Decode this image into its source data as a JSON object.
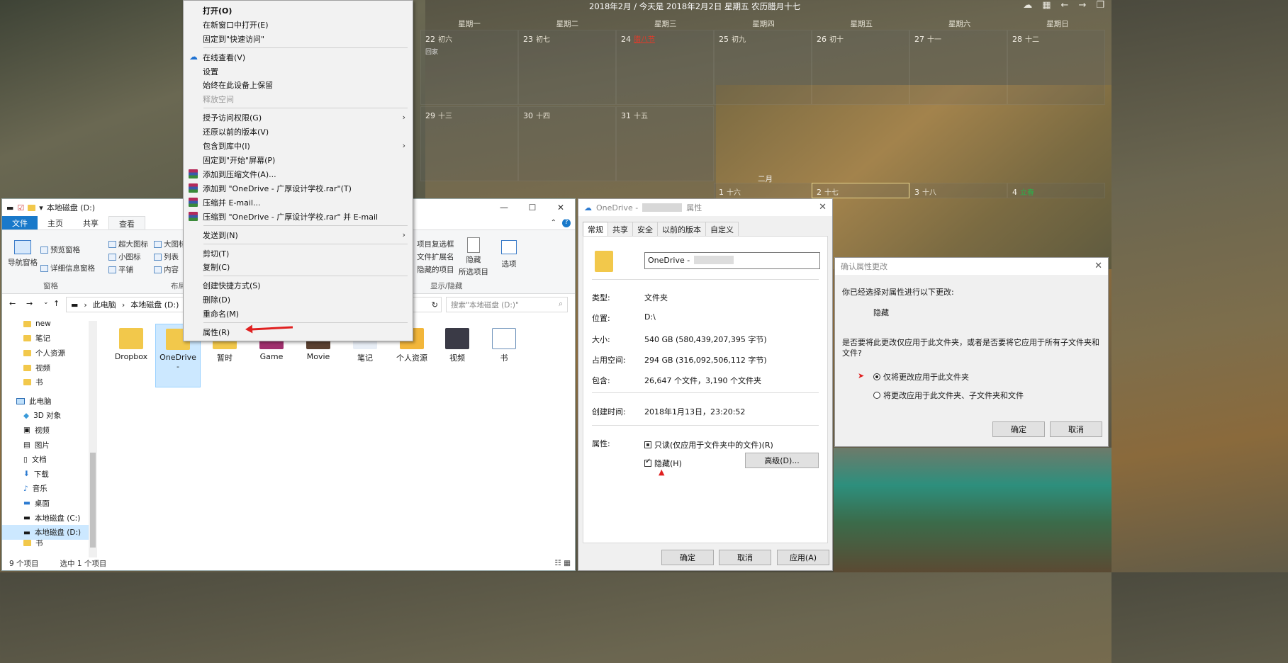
{
  "calendar": {
    "title": "2018年2月 / 今天是 2018年2月2日 星期五 农历腊月十七",
    "weekdays": [
      "星期一",
      "星期二",
      "星期三",
      "星期四",
      "星期五",
      "星期六",
      "星期日"
    ],
    "row1": [
      {
        "day": "22",
        "lunar": "初六",
        "note": "回家"
      },
      {
        "day": "23",
        "lunar": "初七"
      },
      {
        "day": "24",
        "lunar": "腊八节"
      },
      {
        "day": "25",
        "lunar": "初九"
      },
      {
        "day": "26",
        "lunar": "初十"
      },
      {
        "day": "27",
        "lunar": "十一"
      },
      {
        "day": "28",
        "lunar": "十二"
      }
    ],
    "row2": [
      {
        "day": "29",
        "lunar": "十三"
      },
      {
        "day": "30",
        "lunar": "十四"
      },
      {
        "day": "31",
        "lunar": "十五"
      }
    ],
    "feb_label": "二月",
    "row3": [
      {
        "day": "1",
        "lunar": "十六"
      },
      {
        "day": "2",
        "lunar": "十七"
      },
      {
        "day": "3",
        "lunar": "十八"
      },
      {
        "day": "4",
        "lunar": "立春"
      }
    ],
    "icons": [
      "cloud-icon",
      "calendar-icon",
      "back-arrow-icon",
      "forward-arrow-icon",
      "window-icon"
    ]
  },
  "explorer": {
    "title": "本地磁盘 (D:)",
    "tabs": {
      "file": "文件",
      "home": "主页",
      "share": "共享",
      "view": "查看"
    },
    "ribbon": {
      "nav_pane": "导航窗格",
      "preview_pane": "预览窗格",
      "details_pane": "详细信息窗格",
      "panes_group": "窗格",
      "xl_icons": "超大图标",
      "large_icons": "大图标",
      "small_icons": "小图标",
      "list": "列表",
      "tiles": "平铺",
      "content": "内容",
      "layout_group": "布局",
      "item_checkboxes": "项目复选框",
      "file_ext": "文件扩展名",
      "hidden_items": "隐藏的项目",
      "hide_selected": "隐藏",
      "selected_items": "所选项目",
      "options": "选项",
      "show_hide_group": "显示/隐藏"
    },
    "address": {
      "pc": "此电脑",
      "drive": "本地磁盘 (D:)"
    },
    "search_placeholder": "搜索\"本地磁盘 (D:)\"",
    "nav": {
      "folders": [
        "new",
        "笔记",
        "个人资源",
        "视频",
        "书"
      ],
      "this_pc": "此电脑",
      "pc_items": [
        "3D 对象",
        "视频",
        "图片",
        "文档",
        "下载",
        "音乐",
        "桌面",
        "本地磁盘 (C:)",
        "本地磁盘 (D:)"
      ],
      "partial": "书"
    },
    "files": [
      "Dropbox",
      "OneDrive",
      "暂时",
      "Game",
      "Movie",
      "笔记",
      "个人资源",
      "视频",
      "书"
    ],
    "onedrive_sub": "-",
    "status": {
      "count": "9 个项目",
      "selected": "选中 1 个项目"
    }
  },
  "context_menu": {
    "open": "打开(O)",
    "open_new": "在新窗口中打开(E)",
    "pin_quick": "固定到\"快速访问\"",
    "view_online": "在线查看(V)",
    "settings": "设置",
    "keep_device": "始终在此设备上保留",
    "free_space": "释放空间",
    "grant_access": "授予访问权限(G)",
    "restore": "还原以前的版本(V)",
    "include_lib": "包含到库中(I)",
    "pin_start": "固定到\"开始\"屏幕(P)",
    "add_archive": "添加到压缩文件(A)...",
    "add_rar": "添加到 \"OneDrive - 广厚设计学校.rar\"(T)",
    "compress_email": "压缩并 E-mail...",
    "compress_rar_email": "压缩到 \"OneDrive - 广厚设计学校.rar\" 并 E-mail",
    "send_to": "发送到(N)",
    "cut": "剪切(T)",
    "copy": "复制(C)",
    "shortcut": "创建快捷方式(S)",
    "delete": "删除(D)",
    "rename": "重命名(M)",
    "properties": "属性(R)"
  },
  "properties": {
    "title_prefix": "OneDrive -",
    "title_suffix": "属性",
    "tabs": [
      "常规",
      "共享",
      "安全",
      "以前的版本",
      "自定义"
    ],
    "name_value": "OneDrive -",
    "rows": [
      {
        "label": "类型:",
        "value": "文件夹"
      },
      {
        "label": "位置:",
        "value": "D:\\"
      },
      {
        "label": "大小:",
        "value": "540 GB (580,439,207,395 字节)"
      },
      {
        "label": "占用空间:",
        "value": "294 GB (316,092,506,112 字节)"
      },
      {
        "label": "包含:",
        "value": "26,647 个文件，3,190 个文件夹"
      }
    ],
    "created_label": "创建时间:",
    "created_value": "2018年1月13日，23:20:52",
    "attr_label": "属性:",
    "readonly": "只读(仅应用于文件夹中的文件)(R)",
    "hidden": "隐藏(H)",
    "advanced": "高级(D)...",
    "ok": "确定",
    "cancel": "取消",
    "apply": "应用(A)"
  },
  "confirm": {
    "title": "确认属性更改",
    "line1": "你已经选择对属性进行以下更改:",
    "change": "隐藏",
    "question": "是否要将此更改仅应用于此文件夹，或者是否要将它应用于所有子文件夹和文件?",
    "opt1": "仅将更改应用于此文件夹",
    "opt2": "将更改应用于此文件夹、子文件夹和文件",
    "ok": "确定",
    "cancel": "取消"
  }
}
